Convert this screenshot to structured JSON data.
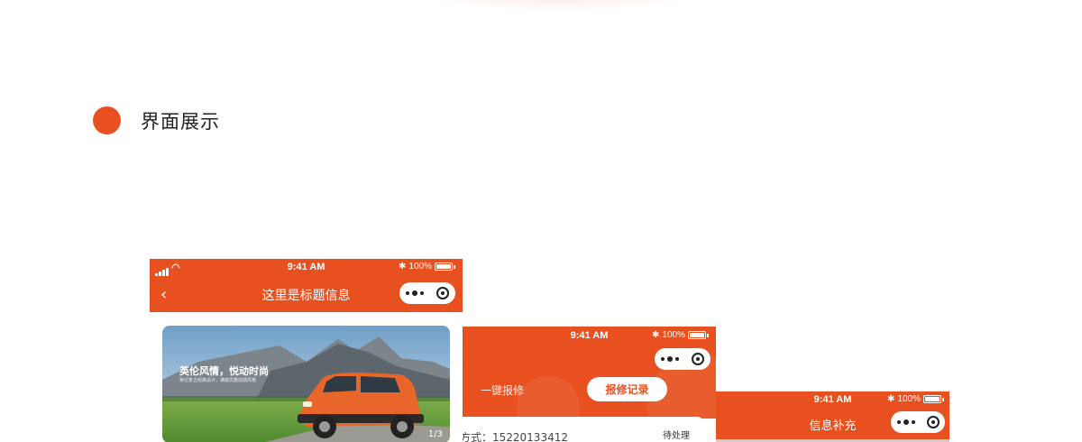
{
  "section": {
    "title": "界面展示"
  },
  "colors": {
    "accent": "#e8501f"
  },
  "screens": [
    {
      "status": {
        "time": "9:41 AM",
        "battery": "100%"
      },
      "nav": {
        "title": "这里是标题信息",
        "back_icon": "chevron-left-icon"
      },
      "banner": {
        "headline": "英伦风情，悦动时尚",
        "subline": "英伦复古经典设计，满载优雅动感风格",
        "page_indicator": "1/3"
      }
    },
    {
      "status": {
        "time": "9:41 AM",
        "battery": "100%"
      },
      "tabs": [
        {
          "label": "一键报修"
        },
        {
          "label": "报修记录",
          "active": true
        }
      ],
      "record": {
        "contact": "方式：15220133412",
        "status": "待处理"
      }
    },
    {
      "status": {
        "time": "9:41 AM",
        "battery": "100%"
      },
      "nav": {
        "title": "信息补充"
      }
    }
  ]
}
